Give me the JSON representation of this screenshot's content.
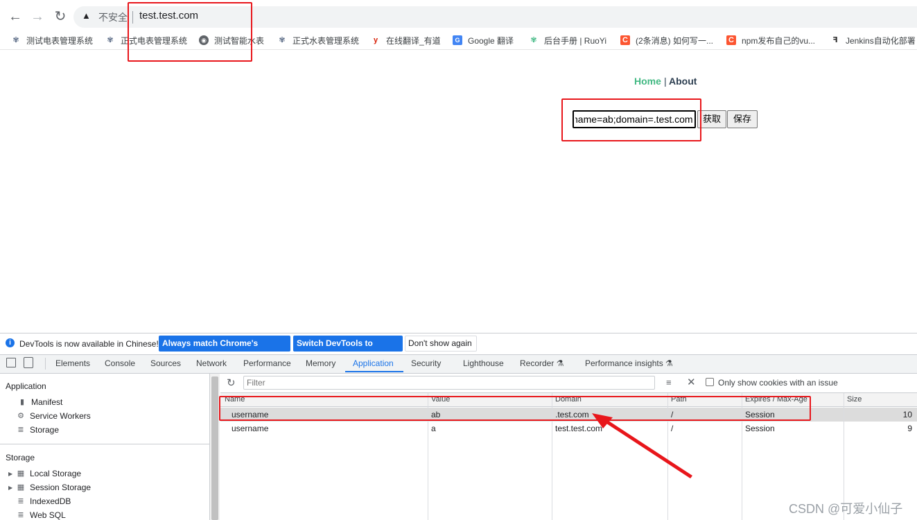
{
  "browser": {
    "back_icon": "←",
    "forward_icon": "→",
    "reload_icon": "↻",
    "insecure_label": "不安全",
    "url": "test.test.com"
  },
  "bookmarks": [
    {
      "label": "测试电表管理系统",
      "icon": "leaf-icon"
    },
    {
      "label": "正式电表管理系统",
      "icon": "leaf-icon"
    },
    {
      "label": "测试智能水表",
      "icon": "globe-icon"
    },
    {
      "label": "正式水表管理系统",
      "icon": "leaf-icon"
    },
    {
      "label": "在线翻译_有道",
      "icon": "youdao-icon"
    },
    {
      "label": "Google 翻译",
      "icon": "google-translate-icon"
    },
    {
      "label": "后台手册 | RuoYi",
      "icon": "vue-icon"
    },
    {
      "label": "(2条消息) 如何写一...",
      "icon": "csdn-icon"
    },
    {
      "label": "npm发布自己的vu...",
      "icon": "csdn-icon"
    },
    {
      "label": "Jenkins自动化部署",
      "icon": "jenkins-icon"
    }
  ],
  "page": {
    "nav_home": "Home",
    "nav_separator": "|",
    "nav_about": "About",
    "cookie_input_value": "name=ab;domain=.test.com",
    "get_button": "获取",
    "save_button": "保存"
  },
  "devtools": {
    "infobar": {
      "message": "DevTools is now available in Chinese!",
      "match_button": "Always match Chrome's language",
      "switch_button": "Switch DevTools to Chinese",
      "dont_show_button": "Don't show again"
    },
    "tabs": [
      {
        "label": "Elements"
      },
      {
        "label": "Console"
      },
      {
        "label": "Sources"
      },
      {
        "label": "Network"
      },
      {
        "label": "Performance"
      },
      {
        "label": "Memory"
      },
      {
        "label": "Application"
      },
      {
        "label": "Security"
      },
      {
        "label": "Lighthouse"
      },
      {
        "label": "Recorder ⚗"
      },
      {
        "label": "Performance insights ⚗"
      }
    ],
    "active_tab": "Application",
    "sidebar": {
      "application_title": "Application",
      "application_items": [
        "Manifest",
        "Service Workers",
        "Storage"
      ],
      "storage_title": "Storage",
      "storage_items": [
        "Local Storage",
        "Session Storage",
        "IndexedDB",
        "Web SQL"
      ]
    },
    "cookies": {
      "filter_placeholder": "Filter",
      "only_issue_label": "Only show cookies with an issue",
      "columns": [
        "Name",
        "Value",
        "Domain",
        "Path",
        "Expires / Max-Age",
        "Size"
      ],
      "rows": [
        {
          "name": "username",
          "value": "ab",
          "domain": ".test.com",
          "path": "/",
          "expires": "Session",
          "size": "10"
        },
        {
          "name": "username",
          "value": "a",
          "domain": "test.test.com",
          "path": "/",
          "expires": "Session",
          "size": "9"
        }
      ]
    }
  },
  "watermark": "CSDN @可爱小仙子",
  "colors": {
    "annotation_red": "#e8161b",
    "devtools_blue": "#1a73e8",
    "vue_green": "#42b983"
  }
}
